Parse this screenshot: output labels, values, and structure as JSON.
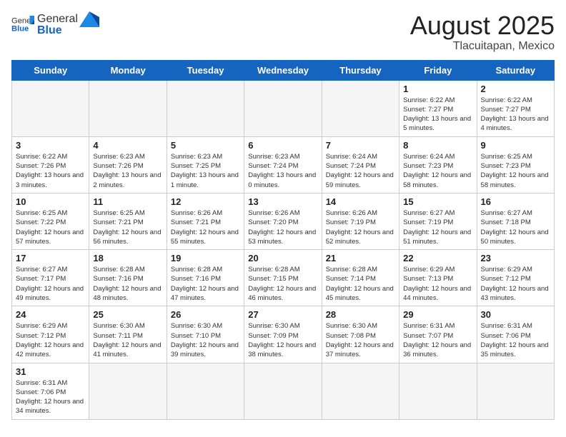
{
  "header": {
    "logo_general": "General",
    "logo_blue": "Blue",
    "month": "August 2025",
    "location": "Tlacuitapan, Mexico"
  },
  "days_of_week": [
    "Sunday",
    "Monday",
    "Tuesday",
    "Wednesday",
    "Thursday",
    "Friday",
    "Saturday"
  ],
  "weeks": [
    [
      {
        "day": "",
        "info": ""
      },
      {
        "day": "",
        "info": ""
      },
      {
        "day": "",
        "info": ""
      },
      {
        "day": "",
        "info": ""
      },
      {
        "day": "",
        "info": ""
      },
      {
        "day": "1",
        "info": "Sunrise: 6:22 AM\nSunset: 7:27 PM\nDaylight: 13 hours\nand 5 minutes."
      },
      {
        "day": "2",
        "info": "Sunrise: 6:22 AM\nSunset: 7:27 PM\nDaylight: 13 hours\nand 4 minutes."
      }
    ],
    [
      {
        "day": "3",
        "info": "Sunrise: 6:22 AM\nSunset: 7:26 PM\nDaylight: 13 hours\nand 3 minutes."
      },
      {
        "day": "4",
        "info": "Sunrise: 6:23 AM\nSunset: 7:26 PM\nDaylight: 13 hours\nand 2 minutes."
      },
      {
        "day": "5",
        "info": "Sunrise: 6:23 AM\nSunset: 7:25 PM\nDaylight: 13 hours\nand 1 minute."
      },
      {
        "day": "6",
        "info": "Sunrise: 6:23 AM\nSunset: 7:24 PM\nDaylight: 13 hours\nand 0 minutes."
      },
      {
        "day": "7",
        "info": "Sunrise: 6:24 AM\nSunset: 7:24 PM\nDaylight: 12 hours\nand 59 minutes."
      },
      {
        "day": "8",
        "info": "Sunrise: 6:24 AM\nSunset: 7:23 PM\nDaylight: 12 hours\nand 58 minutes."
      },
      {
        "day": "9",
        "info": "Sunrise: 6:25 AM\nSunset: 7:23 PM\nDaylight: 12 hours\nand 58 minutes."
      }
    ],
    [
      {
        "day": "10",
        "info": "Sunrise: 6:25 AM\nSunset: 7:22 PM\nDaylight: 12 hours\nand 57 minutes."
      },
      {
        "day": "11",
        "info": "Sunrise: 6:25 AM\nSunset: 7:21 PM\nDaylight: 12 hours\nand 56 minutes."
      },
      {
        "day": "12",
        "info": "Sunrise: 6:26 AM\nSunset: 7:21 PM\nDaylight: 12 hours\nand 55 minutes."
      },
      {
        "day": "13",
        "info": "Sunrise: 6:26 AM\nSunset: 7:20 PM\nDaylight: 12 hours\nand 53 minutes."
      },
      {
        "day": "14",
        "info": "Sunrise: 6:26 AM\nSunset: 7:19 PM\nDaylight: 12 hours\nand 52 minutes."
      },
      {
        "day": "15",
        "info": "Sunrise: 6:27 AM\nSunset: 7:19 PM\nDaylight: 12 hours\nand 51 minutes."
      },
      {
        "day": "16",
        "info": "Sunrise: 6:27 AM\nSunset: 7:18 PM\nDaylight: 12 hours\nand 50 minutes."
      }
    ],
    [
      {
        "day": "17",
        "info": "Sunrise: 6:27 AM\nSunset: 7:17 PM\nDaylight: 12 hours\nand 49 minutes."
      },
      {
        "day": "18",
        "info": "Sunrise: 6:28 AM\nSunset: 7:16 PM\nDaylight: 12 hours\nand 48 minutes."
      },
      {
        "day": "19",
        "info": "Sunrise: 6:28 AM\nSunset: 7:16 PM\nDaylight: 12 hours\nand 47 minutes."
      },
      {
        "day": "20",
        "info": "Sunrise: 6:28 AM\nSunset: 7:15 PM\nDaylight: 12 hours\nand 46 minutes."
      },
      {
        "day": "21",
        "info": "Sunrise: 6:28 AM\nSunset: 7:14 PM\nDaylight: 12 hours\nand 45 minutes."
      },
      {
        "day": "22",
        "info": "Sunrise: 6:29 AM\nSunset: 7:13 PM\nDaylight: 12 hours\nand 44 minutes."
      },
      {
        "day": "23",
        "info": "Sunrise: 6:29 AM\nSunset: 7:12 PM\nDaylight: 12 hours\nand 43 minutes."
      }
    ],
    [
      {
        "day": "24",
        "info": "Sunrise: 6:29 AM\nSunset: 7:12 PM\nDaylight: 12 hours\nand 42 minutes."
      },
      {
        "day": "25",
        "info": "Sunrise: 6:30 AM\nSunset: 7:11 PM\nDaylight: 12 hours\nand 41 minutes."
      },
      {
        "day": "26",
        "info": "Sunrise: 6:30 AM\nSunset: 7:10 PM\nDaylight: 12 hours\nand 39 minutes."
      },
      {
        "day": "27",
        "info": "Sunrise: 6:30 AM\nSunset: 7:09 PM\nDaylight: 12 hours\nand 38 minutes."
      },
      {
        "day": "28",
        "info": "Sunrise: 6:30 AM\nSunset: 7:08 PM\nDaylight: 12 hours\nand 37 minutes."
      },
      {
        "day": "29",
        "info": "Sunrise: 6:31 AM\nSunset: 7:07 PM\nDaylight: 12 hours\nand 36 minutes."
      },
      {
        "day": "30",
        "info": "Sunrise: 6:31 AM\nSunset: 7:06 PM\nDaylight: 12 hours\nand 35 minutes."
      }
    ],
    [
      {
        "day": "31",
        "info": "Sunrise: 6:31 AM\nSunset: 7:06 PM\nDaylight: 12 hours\nand 34 minutes."
      },
      {
        "day": "",
        "info": ""
      },
      {
        "day": "",
        "info": ""
      },
      {
        "day": "",
        "info": ""
      },
      {
        "day": "",
        "info": ""
      },
      {
        "day": "",
        "info": ""
      },
      {
        "day": "",
        "info": ""
      }
    ]
  ]
}
